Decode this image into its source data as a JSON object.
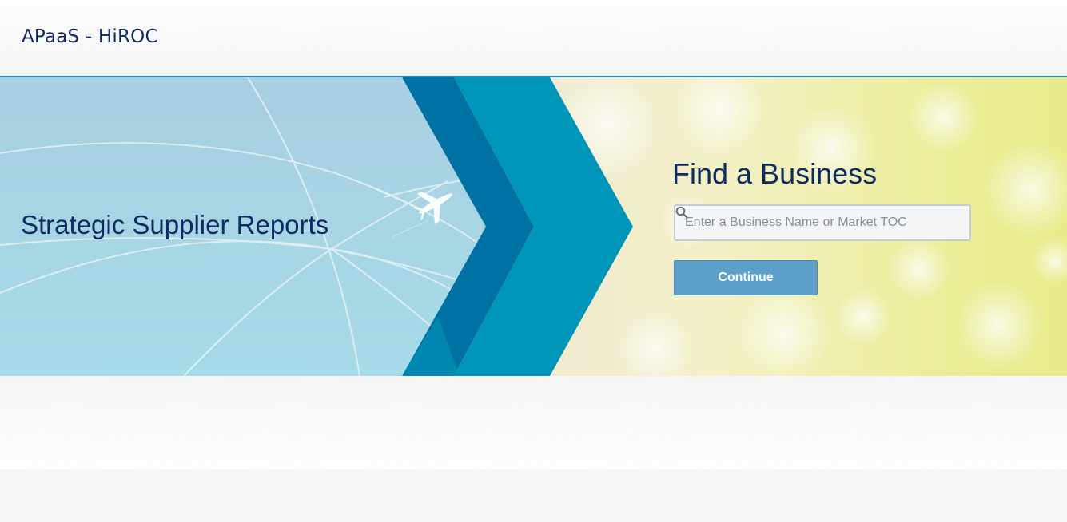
{
  "header": {
    "app_title": "APaaS - HiROC"
  },
  "hero": {
    "title": "Strategic Supplier Reports"
  },
  "search_panel": {
    "title": "Find a Business",
    "placeholder": "Enter a Business Name or Market TOC",
    "search_icon": "search-icon",
    "continue_label": "Continue"
  },
  "colors": {
    "brand_navy": "#0e2c63",
    "accent_blue": "#1f8ec5",
    "button_blue": "#5c9fc8",
    "chevron_dark": "#0071a3",
    "chevron_light": "#0096b9"
  }
}
